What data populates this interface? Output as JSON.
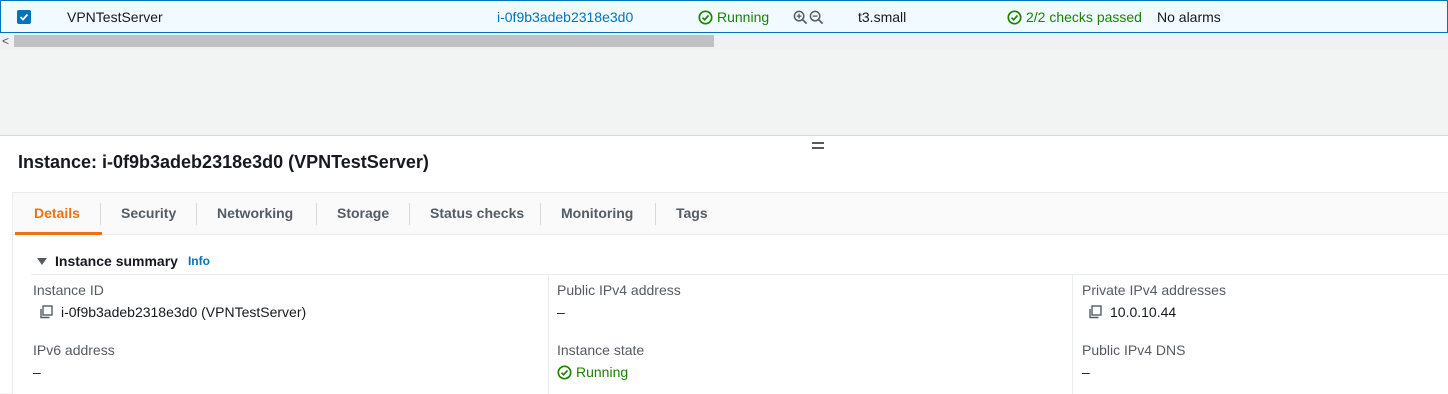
{
  "row": {
    "name": "VPNTestServer",
    "instance_id": "i-0f9b3adeb2318e3d0",
    "state": "Running",
    "instance_type": "t3.small",
    "status_checks": "2/2 checks passed",
    "alarms": "No alarms",
    "selected": true
  },
  "scrollbar": {
    "left_arrow": "<"
  },
  "details": {
    "title": "Instance: i-0f9b3adeb2318e3d0 (VPNTestServer)",
    "tabs": [
      {
        "label": "Details",
        "active": true
      },
      {
        "label": "Security"
      },
      {
        "label": "Networking"
      },
      {
        "label": "Storage"
      },
      {
        "label": "Status checks"
      },
      {
        "label": "Monitoring"
      },
      {
        "label": "Tags"
      }
    ],
    "summary": {
      "title": "Instance summary",
      "info": "Info",
      "fields": {
        "instance_id": {
          "label": "Instance ID",
          "value": "i-0f9b3adeb2318e3d0 (VPNTestServer)"
        },
        "public_ipv4": {
          "label": "Public IPv4 address",
          "value": "–"
        },
        "private_ipv4": {
          "label": "Private IPv4 addresses",
          "value": "10.0.10.44"
        },
        "ipv6": {
          "label": "IPv6 address",
          "value": "–"
        },
        "instance_state": {
          "label": "Instance state",
          "value": "Running"
        },
        "public_dns": {
          "label": "Public IPv4 DNS",
          "value": "–"
        }
      }
    }
  },
  "colors": {
    "accent": "#ec7211",
    "link": "#0073bb",
    "success": "#1d8102",
    "selected_row_bg": "#f1faff"
  },
  "icons": [
    "checkbox-checked-icon",
    "success-circle-icon",
    "zoom-in-icon",
    "zoom-out-icon",
    "copy-icon",
    "caret-down-icon",
    "resize-handle-icon"
  ]
}
